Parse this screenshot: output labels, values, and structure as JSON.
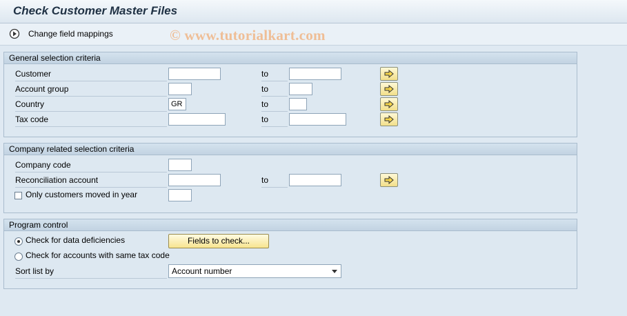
{
  "window": {
    "title": "Check Customer Master Files"
  },
  "toolbar": {
    "change_mappings_label": "Change field mappings"
  },
  "watermark": "© www.tutorialkart.com",
  "general": {
    "header": "General selection criteria",
    "to_label": "to",
    "rows": [
      {
        "label": "Customer",
        "from": "",
        "to": ""
      },
      {
        "label": "Account group",
        "from": "",
        "to": ""
      },
      {
        "label": "Country",
        "from": "GR",
        "to": ""
      },
      {
        "label": "Tax code",
        "from": "",
        "to": ""
      }
    ]
  },
  "company": {
    "header": "Company related selection criteria",
    "to_label": "to",
    "company_code_label": "Company code",
    "company_code_value": "",
    "recon_label": "Reconciliation account",
    "recon_from": "",
    "recon_to": "",
    "moved_label": "Only customers moved in year",
    "moved_checked": false,
    "moved_year": ""
  },
  "program": {
    "header": "Program control",
    "radio_deficiencies_label": "Check for data deficiencies",
    "radio_deficiencies_selected": true,
    "fields_button_label": "Fields to check...",
    "radio_taxcode_label": "Check for accounts with same tax code",
    "radio_taxcode_selected": false,
    "sort_label": "Sort list by",
    "sort_value": "Account number"
  },
  "colors": {
    "background": "#dfe9f2",
    "title_text": "#1f3144",
    "button_yellow": "#f7e48f",
    "watermark": "#f0b98c"
  }
}
